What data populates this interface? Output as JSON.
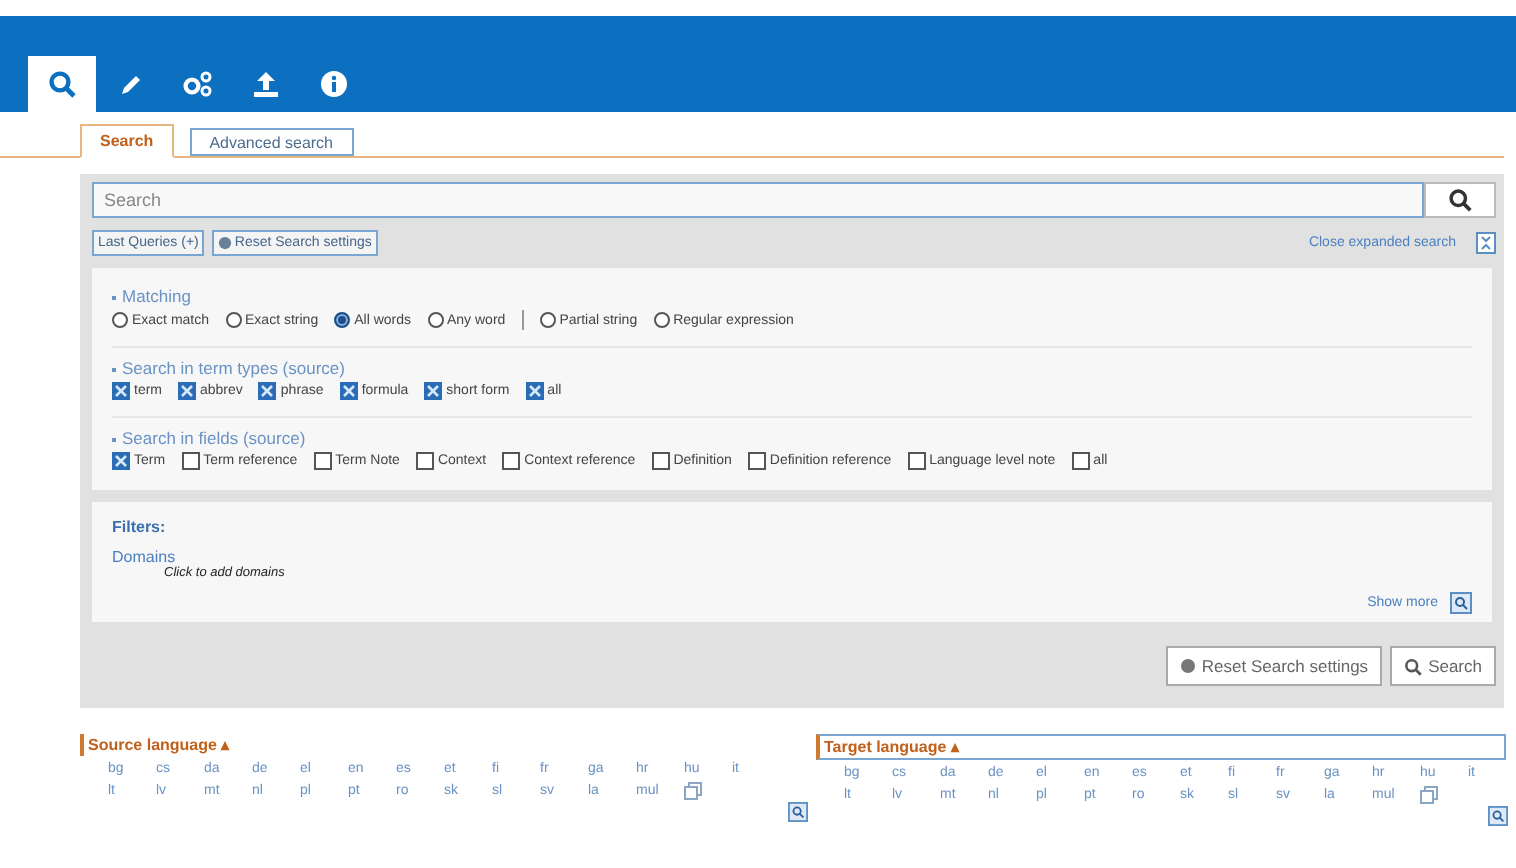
{
  "header_tabs": [
    {
      "kind": "search",
      "selected": true
    },
    {
      "kind": "pencil",
      "selected": false
    },
    {
      "kind": "gears",
      "selected": false
    },
    {
      "kind": "upload",
      "selected": false
    },
    {
      "kind": "info",
      "selected": false
    }
  ],
  "subtabs": [
    {
      "label": "Search",
      "selected": true
    },
    {
      "label": "Advanced search",
      "selected": false
    }
  ],
  "search": {
    "placeholder": "Search"
  },
  "last_queries": "Last Queries (+)",
  "reset_small": "Reset Search settings",
  "close_expanded": "Close expanded search",
  "matching": {
    "title": "Matching",
    "options": [
      {
        "label": "Exact match",
        "selected": false,
        "divider_before": false
      },
      {
        "label": "Exact string",
        "selected": false,
        "divider_before": false
      },
      {
        "label": "All words",
        "selected": true,
        "divider_before": false
      },
      {
        "label": "Any word",
        "selected": false,
        "divider_before": false
      },
      {
        "label": "Partial string",
        "selected": false,
        "divider_before": true
      },
      {
        "label": "Regular expression",
        "selected": false,
        "divider_before": false
      }
    ]
  },
  "term_types": {
    "title": "Search in term types (source)",
    "options": [
      {
        "label": "term",
        "checked": true
      },
      {
        "label": "abbrev",
        "checked": true
      },
      {
        "label": "phrase",
        "checked": true
      },
      {
        "label": "formula",
        "checked": true
      },
      {
        "label": "short form",
        "checked": true
      },
      {
        "label": "all",
        "checked": true
      }
    ]
  },
  "fields": {
    "title": "Search in fields (source)",
    "options": [
      {
        "label": "Term",
        "checked": true
      },
      {
        "label": "Term reference",
        "checked": false
      },
      {
        "label": "Term Note",
        "checked": false
      },
      {
        "label": "Context",
        "checked": false
      },
      {
        "label": "Context reference",
        "checked": false
      },
      {
        "label": "Definition",
        "checked": false
      },
      {
        "label": "Definition reference",
        "checked": false
      },
      {
        "label": "Language level note",
        "checked": false
      },
      {
        "label": "all",
        "checked": false
      }
    ]
  },
  "filters": {
    "title": "Filters:",
    "domains": "Domains",
    "domains_hint": "Click to add domains",
    "show_more": "Show more"
  },
  "actions": [
    {
      "kind": "reset",
      "label": "Reset Search settings"
    },
    {
      "kind": "search",
      "label": "Search"
    }
  ],
  "languages": [
    {
      "title": "Source language",
      "arrow": "▴",
      "focused": false,
      "rows": [
        [
          "bg",
          "cs",
          "da",
          "de",
          "el",
          "en",
          "es",
          "et",
          "fi",
          "fr",
          "ga",
          "hr",
          "hu",
          "it"
        ],
        [
          "lt",
          "lv",
          "mt",
          "nl",
          "pl",
          "pt",
          "ro",
          "sk",
          "sl",
          "sv",
          "la",
          "mul"
        ]
      ]
    },
    {
      "title": "Target language",
      "arrow": "▴",
      "focused": true,
      "rows": [
        [
          "bg",
          "cs",
          "da",
          "de",
          "el",
          "en",
          "es",
          "et",
          "fi",
          "fr",
          "ga",
          "hr",
          "hu",
          "it"
        ],
        [
          "lt",
          "lv",
          "mt",
          "nl",
          "pl",
          "pt",
          "ro",
          "sk",
          "sl",
          "sv",
          "la",
          "mul"
        ]
      ]
    }
  ]
}
